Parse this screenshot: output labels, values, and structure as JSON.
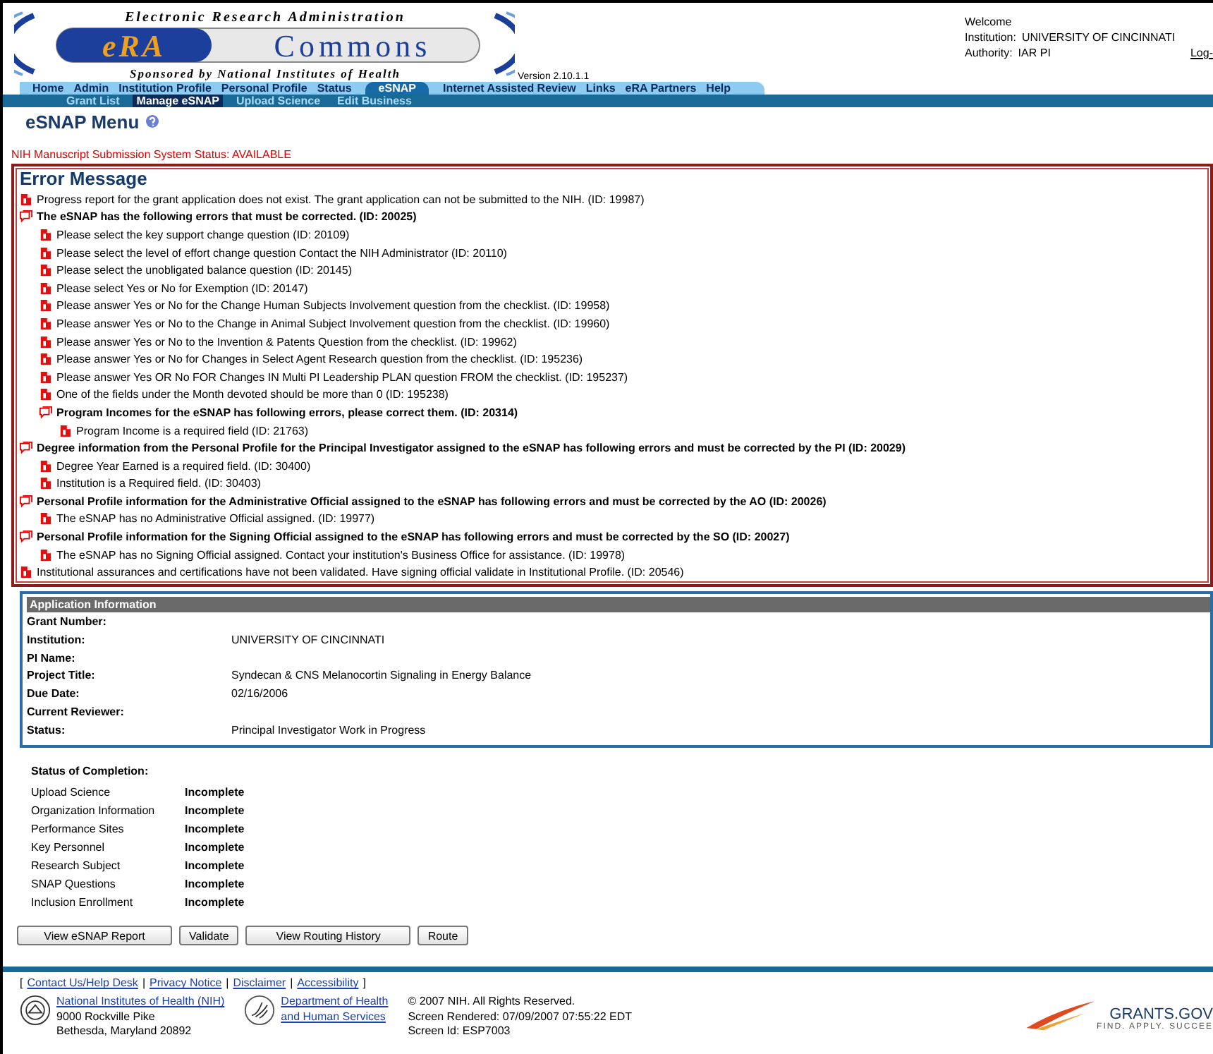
{
  "header": {
    "logo": {
      "top": "Electronic Research Administration",
      "era": "eRA",
      "commons": "Commons",
      "bottom": "Sponsored by National Institutes of Health"
    },
    "version": "Version 2.10.1.1",
    "user": [
      {
        "label": "Welcome"
      },
      {
        "label": "Institution:",
        "value": "UNIVERSITY OF CINCINNATI"
      },
      {
        "label": "Authority:",
        "value": "IAR  PI"
      }
    ],
    "logout": "Log-"
  },
  "nav": [
    {
      "label": "Home",
      "selected": false
    },
    {
      "label": "Admin",
      "selected": false
    },
    {
      "label": "Institution Profile",
      "selected": false
    },
    {
      "label": "Personal Profile",
      "selected": false
    },
    {
      "label": "Status",
      "selected": false
    },
    {
      "label": "eSNAP",
      "selected": true
    },
    {
      "label": "Internet Assisted Review",
      "selected": false
    },
    {
      "label": "Links",
      "selected": false
    },
    {
      "label": "eRA Partners",
      "selected": false
    },
    {
      "label": "Help",
      "selected": false
    }
  ],
  "subnav": [
    {
      "label": "Grant List",
      "selected": false
    },
    {
      "label": "Manage eSNAP",
      "selected": true
    },
    {
      "label": "Upload Science",
      "selected": false
    },
    {
      "label": "Edit Business",
      "selected": false
    }
  ],
  "page_title": "eSNAP Menu",
  "system_status": "NIH Manuscript Submission System Status: AVAILABLE",
  "errors": {
    "title": "Error Message",
    "items": [
      {
        "kind": "error",
        "text": "Progress report for the grant application does not exist. The grant application can not be submitted to the NIH. (ID: 19987)"
      },
      {
        "kind": "group",
        "text": "The eSNAP has the following errors that must be corrected. (ID: 20025)",
        "children": [
          {
            "kind": "error",
            "text": "Please select the key support change question (ID: 20109)"
          },
          {
            "kind": "error",
            "text": "Please select the level of effort change question Contact the NIH Administrator (ID: 20110)"
          },
          {
            "kind": "error",
            "text": "Please select the unobligated balance question (ID: 20145)"
          },
          {
            "kind": "error",
            "text": "Please select Yes or No for Exemption (ID: 20147)"
          },
          {
            "kind": "error",
            "text": "Please answer Yes or No for the Change Human Subjects Involvement question from the checklist. (ID: 19958)"
          },
          {
            "kind": "error",
            "text": "Please answer Yes or No to the Change in Animal Subject Involvement question from the checklist. (ID: 19960)"
          },
          {
            "kind": "error",
            "text": "Please answer Yes or No to the Invention & Patents Question from the checklist. (ID: 19962)"
          },
          {
            "kind": "error",
            "text": "Please answer Yes or No for Changes in Select Agent Research question from the checklist. (ID: 195236)"
          },
          {
            "kind": "error",
            "text": "Please answer Yes OR No FOR Changes IN Multi PI Leadership PLAN question FROM the checklist. (ID: 195237)"
          },
          {
            "kind": "error",
            "text": "One of the fields under the Month devoted should be more than 0 (ID: 195238)"
          },
          {
            "kind": "group",
            "text": "Program Incomes for the eSNAP has following errors, please correct them. (ID: 20314)",
            "children": [
              {
                "kind": "error",
                "text": "Program Income is a required field (ID: 21763)"
              }
            ]
          }
        ]
      },
      {
        "kind": "group",
        "text": "Degree information from the Personal Profile for the Principal Investigator assigned to the eSNAP has following errors and must be corrected by the PI (ID: 20029)",
        "children": [
          {
            "kind": "error",
            "text": "Degree Year Earned is a required field. (ID: 30400)"
          },
          {
            "kind": "error",
            "text": "Institution is a Required field. (ID: 30403)"
          }
        ]
      },
      {
        "kind": "group",
        "text": "Personal Profile information for the Administrative Official assigned to the eSNAP has following errors and must be corrected by the AO (ID: 20026)",
        "children": [
          {
            "kind": "error",
            "text": "The eSNAP has no Administrative Official assigned. (ID: 19977)"
          }
        ]
      },
      {
        "kind": "group",
        "text": "Personal Profile information for the Signing Official assigned to the eSNAP has following errors and must be corrected by the SO (ID: 20027)",
        "children": [
          {
            "kind": "error",
            "text": "The eSNAP has no Signing Official assigned. Contact your institution's Business Office for assistance. (ID: 19978)"
          }
        ]
      },
      {
        "kind": "error",
        "text": "Institutional assurances and certifications have not been validated. Have signing official validate in Institutional Profile. (ID: 20546)"
      }
    ]
  },
  "application_info": {
    "title": "Application Information",
    "rows": [
      {
        "label": "Grant Number:"
      },
      {
        "label": "Institution:",
        "value": "UNIVERSITY OF CINCINNATI"
      },
      {
        "label": "PI Name:"
      },
      {
        "label": "Project Title:",
        "value": "Syndecan & CNS Melanocortin Signaling in Energy Balance"
      },
      {
        "label": "Due Date:",
        "value": "02/16/2006"
      },
      {
        "label": "Current Reviewer:"
      },
      {
        "label": "Status:",
        "value": "Principal Investigator Work in Progress"
      }
    ]
  },
  "completion": {
    "title": "Status of Completion:",
    "rows": [
      {
        "label": "Upload Science",
        "value": "Incomplete"
      },
      {
        "label": "Organization Information",
        "value": "Incomplete"
      },
      {
        "label": "Performance Sites",
        "value": "Incomplete"
      },
      {
        "label": "Key Personnel",
        "value": "Incomplete"
      },
      {
        "label": "Research Subject",
        "value": "Incomplete"
      },
      {
        "label": "SNAP Questions",
        "value": "Incomplete"
      },
      {
        "label": "Inclusion Enrollment",
        "value": "Incomplete"
      }
    ]
  },
  "buttons": [
    "View eSNAP Report",
    "Validate",
    "View Routing History",
    "Route"
  ],
  "footer": {
    "open": "[",
    "separator": "|",
    "close": "]",
    "links": [
      "Contact Us/Help Desk",
      "Privacy Notice",
      "Disclaimer",
      "Accessibility"
    ],
    "nih": {
      "link": "National Institutes of Health (NIH)",
      "lines": [
        "9000 Rockville Pike",
        "Bethesda, Maryland 20892"
      ]
    },
    "hhs": [
      "Department of Health",
      "and Human Services"
    ],
    "info": [
      "© 2007 NIH. All Rights Reserved.",
      "Screen Rendered: 07/09/2007 07:55:22 EDT",
      "Screen Id: ESP7003"
    ],
    "grants": {
      "name": "GRANTS.GOV",
      "tagline": "FIND. APPLY. SUCCEE"
    }
  }
}
